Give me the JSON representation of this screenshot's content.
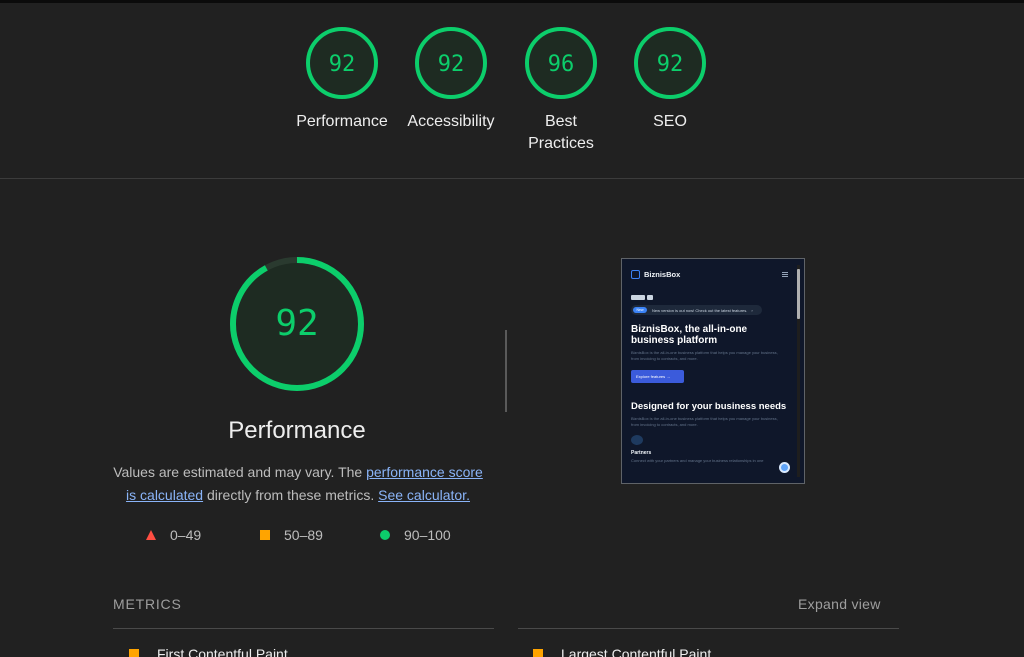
{
  "scores": [
    {
      "label": "Performance",
      "score": "92",
      "value": 92,
      "key": "performance"
    },
    {
      "label": "Accessibility",
      "score": "92",
      "value": 92,
      "key": "accessibility"
    },
    {
      "label": "Best Practices",
      "score": "96",
      "value": 96,
      "key": "best-practices"
    },
    {
      "label": "SEO",
      "score": "92",
      "value": 92,
      "key": "seo"
    }
  ],
  "colors": {
    "pass": "#0cce6b",
    "average": "#ffa400",
    "fail": "#ff4e42",
    "link": "#8ab4f8"
  },
  "performance": {
    "score": "92",
    "value": 92,
    "title": "Performance",
    "desc_part1": "Values are estimated and may vary. The ",
    "link1": "performance score is calculated",
    "desc_part2": " directly from these metrics. ",
    "link2": "See calculator."
  },
  "legend": [
    {
      "range": "0–49",
      "icon": "triangle-icon"
    },
    {
      "range": "50–89",
      "icon": "square-icon"
    },
    {
      "range": "90–100",
      "icon": "circle-icon"
    }
  ],
  "screenshot": {
    "brand": "BiznisBox",
    "announce_pill": "New",
    "announce_text": "New version is out now! Check out the latest features.",
    "announce_arrow": "›",
    "hero_title": "BiznisBox, the all-in-one business platform",
    "hero_text": "BiznisBox is the all-in-one business platform that helps you manage your business, from invoicing to contracts, and more.",
    "cta": "Explore features →",
    "section_title": "Designed for your business needs",
    "section_text": "BiznisBox is the all-in-one business platform that helps you manage your business, from invoicing to contracts, and more.",
    "feature_title": "Partners",
    "feature_text": "Connect with your partners and manage your business relationships in one"
  },
  "metrics": {
    "title": "METRICS",
    "expand": "Expand view",
    "items": [
      "First Contentful Paint",
      "Largest Contentful Paint"
    ]
  }
}
